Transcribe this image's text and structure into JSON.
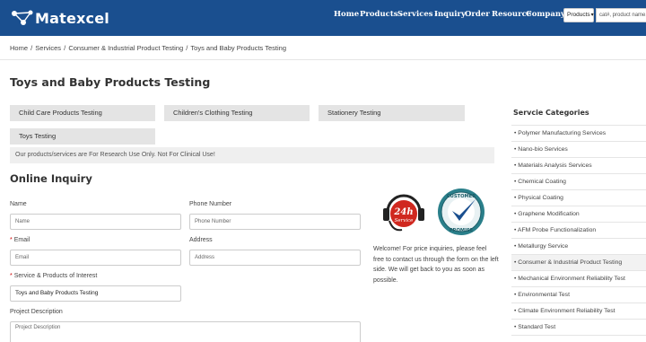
{
  "header": {
    "brand": "Matexcel",
    "nav": [
      {
        "label": "Home",
        "has_dropdown": false
      },
      {
        "label": "Products",
        "has_dropdown": true
      },
      {
        "label": "Services",
        "has_dropdown": true
      },
      {
        "label": "Inquiry",
        "has_dropdown": false
      },
      {
        "label": "Order",
        "has_dropdown": false
      },
      {
        "label": "Resource",
        "has_dropdown": false
      },
      {
        "label": "Company",
        "has_dropdown": true
      }
    ],
    "search_scope": "Products",
    "search_placeholder": "cat#, product name,",
    "colors": {
      "header_bg": "#1a4f8f",
      "accent_red": "#d0281f",
      "accent_teal": "#2a7f8a"
    }
  },
  "breadcrumb": [
    "Home",
    "Services",
    "Consumer & Industrial Product Testing",
    "Toys and Baby Products Testing"
  ],
  "page_title": "Toys and Baby Products Testing",
  "categories": [
    "Child Care Products Testing",
    "Children's Clothing Testing",
    "Stationery Testing",
    "Toys Testing"
  ],
  "notice": "Our products/services are For Research Use Only. Not For Clinical Use!",
  "inquiry": {
    "title": "Online Inquiry",
    "name_label": "Name",
    "name_placeholder": "Name",
    "phone_label": "Phone Number",
    "phone_placeholder": "Phone Number",
    "email_label": "Email",
    "email_placeholder": "Email",
    "address_label": "Address",
    "address_placeholder": "Address",
    "service_label": "Service & Products of Interest",
    "service_value": "Toys and Baby Products Testing",
    "description_label": "Project Description",
    "description_placeholder": "Project Description",
    "required_mark": "*"
  },
  "badges": {
    "service_24h_top": "24h",
    "service_24h_bottom": "Service",
    "customer_promise_top": "CUSTOMER",
    "customer_promise_bottom": "PROMISE"
  },
  "welcome_text": "Welcome! For price inquiries, please feel free to contact us through the form on the left side. We will get back to you as soon as possible.",
  "sidebar": {
    "title": "Servcie Categories",
    "items": [
      "Polymer Manufacturing Services",
      "Nano-bio Services",
      "Materials Analysis Services",
      "Chemical Coating",
      "Physical Coating",
      "Graphene Modification",
      "AFM Probe Functionalization",
      "Metallurgy Service",
      "Consumer & Industrial Product Testing",
      "Mechanical Environment Reliability Test",
      "Environmental Test",
      "Climate Environment Reliability Test",
      "Standard Test"
    ],
    "active_index": 8,
    "bullet": "•"
  }
}
